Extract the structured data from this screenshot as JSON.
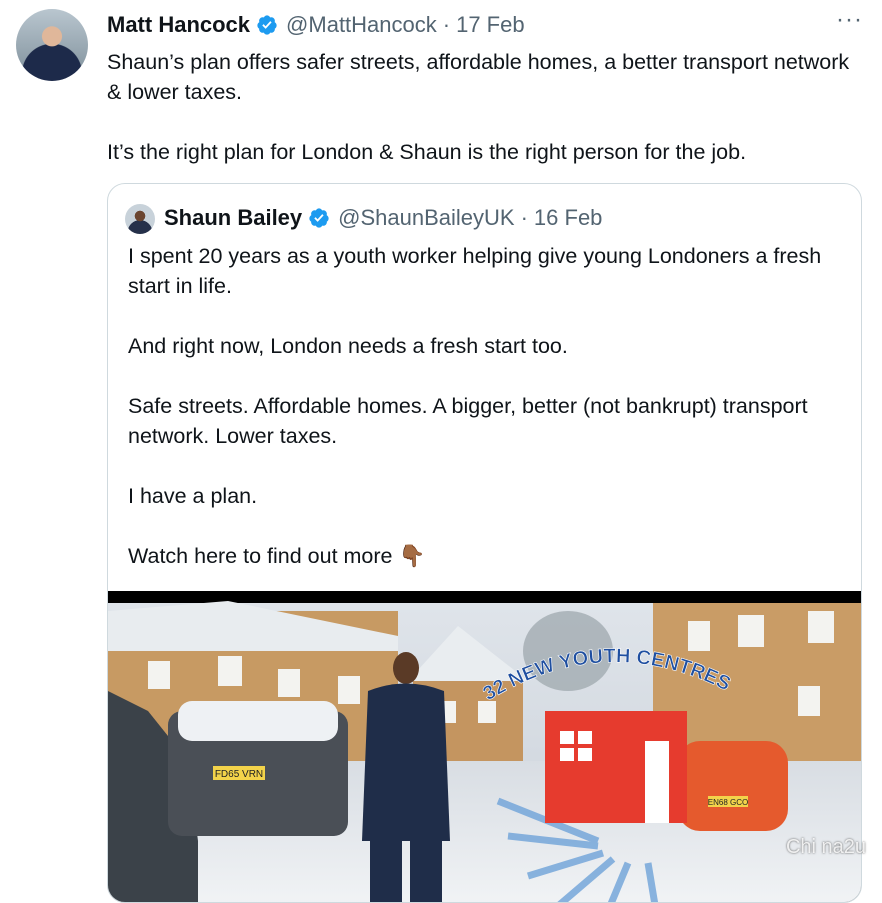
{
  "tweet": {
    "author_name": "Matt Hancock",
    "handle": "@MattHancock",
    "separator": "·",
    "date": "17 Feb",
    "more_label": "···",
    "paragraphs": [
      "Shaun’s plan offers safer streets, affordable homes, a better transport network & lower taxes.",
      "It’s the right plan for London & Shaun is the right person for the job."
    ]
  },
  "quoted_tweet": {
    "author_name": "Shaun Bailey",
    "handle": "@ShaunBaileyUK",
    "separator": "·",
    "date": "16 Feb",
    "paragraphs": [
      "I spent 20 years as a youth worker helping give young Londoners a fresh start in life.",
      "And right now, London needs a fresh start too.",
      "Safe streets. Affordable homes. A bigger, better (not bankrupt) transport network. Lower taxes.",
      "I have a plan.",
      "Watch here to find out more 👇🏾"
    ],
    "media": {
      "overlay_text": "32 NEW YOUTH CENTRES",
      "plate_1": "FD65 VRN",
      "plate_2": "EN68 GCO"
    }
  },
  "watermark": "Chi na2u",
  "colors": {
    "verified": "#1d9bf0",
    "secondary_text": "#536471",
    "border": "#cfd9de",
    "graphic_red": "#e63b2e",
    "graphic_blue": "#1f4fa0"
  }
}
